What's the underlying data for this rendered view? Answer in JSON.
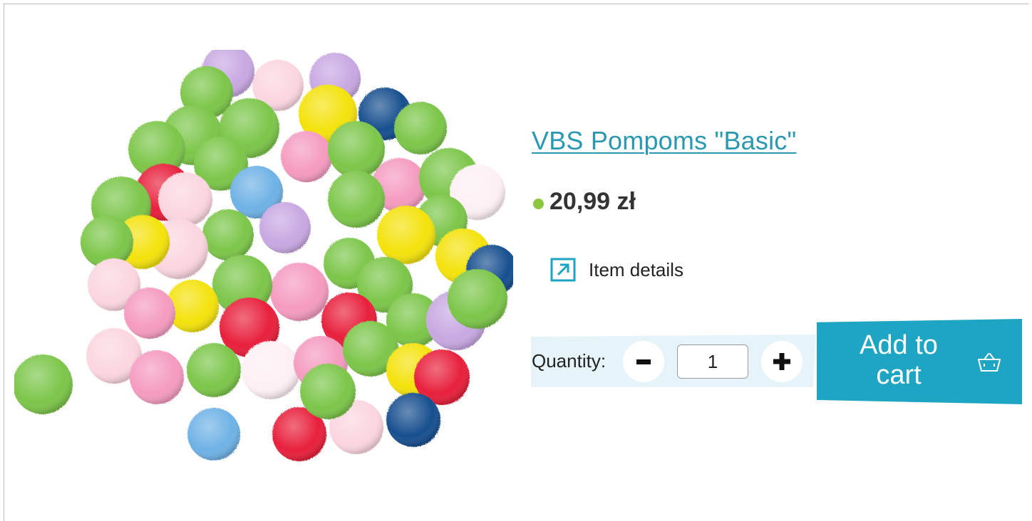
{
  "product": {
    "title": "VBS Pompoms \"Basic\"",
    "price": "20,99 zł",
    "details_label": "Item details",
    "image_icon": "pompom-cluster-image"
  },
  "quantity": {
    "label": "Quantity:",
    "value": "1",
    "minus_icon": "minus-icon",
    "plus_icon": "plus-icon"
  },
  "cart": {
    "label_line1": "Add to",
    "label_line2": "cart",
    "icon": "basket-icon"
  },
  "colors": {
    "accent": "#1ea5c4",
    "title": "#2a98b0",
    "price_dot": "#8cc63f",
    "qty_bg": "#e6f4f9"
  }
}
